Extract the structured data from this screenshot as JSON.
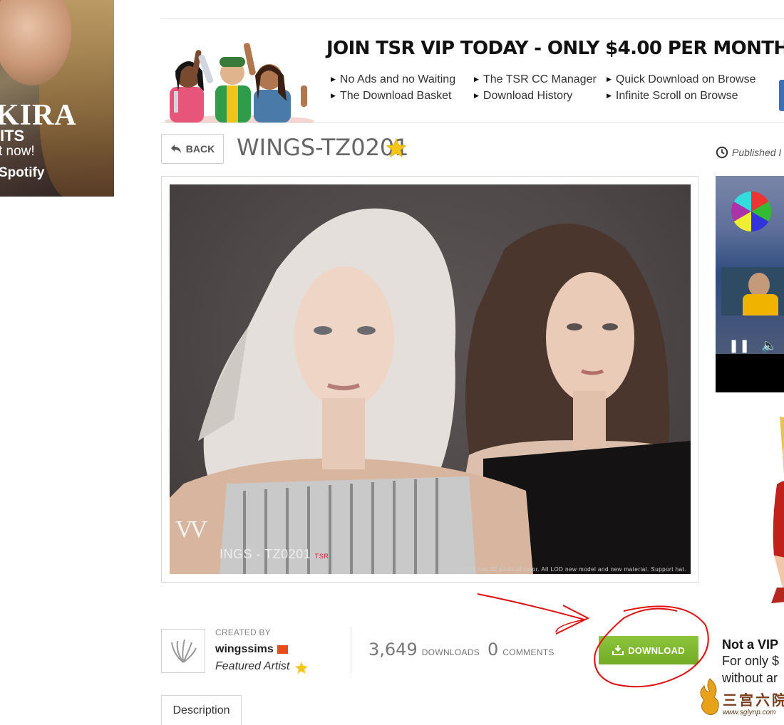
{
  "left_ad": {
    "line1": "KIRA",
    "line2": "ITS",
    "line3": "t now!",
    "line4": "Spotify"
  },
  "vip": {
    "title": "JOIN TSR VIP TODAY - ONLY $4.00 PER MONTH!",
    "features": [
      "No Ads and no Waiting",
      "The Download Basket",
      "The TSR CC Manager",
      "Download History",
      "Quick Download on Browse",
      "Infinite Scroll on Browse"
    ]
  },
  "item": {
    "back_label": "BACK",
    "title": "WINGS-TZ0201",
    "published": "Published I",
    "watermark_line": "INGS - TZ0201",
    "watermark_tag": "TSR",
    "caption": "The hairstyle has 20 kinds of color. All LOD new model and new material. Support hat."
  },
  "creator": {
    "created_by_label": "CREATED BY",
    "name": "wingssims",
    "badge": "Featured Artist"
  },
  "stats": {
    "downloads_value": "3,649",
    "downloads_label": "DOWNLOADS",
    "comments_value": "0",
    "comments_label": "COMMENTS"
  },
  "download": {
    "label": "DOWNLOAD"
  },
  "vip_promo": {
    "title": "Not a VIP",
    "line1": "For only $",
    "line2": "without ar"
  },
  "tabs": {
    "description": "Description"
  },
  "site_watermark": {
    "cn": "三宫六院",
    "url": "www.sglynp.com"
  },
  "colors": {
    "download_green": "#7cb32f",
    "star_gold": "#f5c518",
    "annotation_red": "#e01010",
    "vip_blue": "#3d6fb7"
  },
  "icons": [
    "back-arrow-icon",
    "star-icon",
    "clock-icon",
    "download-icon",
    "play-pause-icon",
    "mute-icon",
    "flag-icon"
  ]
}
